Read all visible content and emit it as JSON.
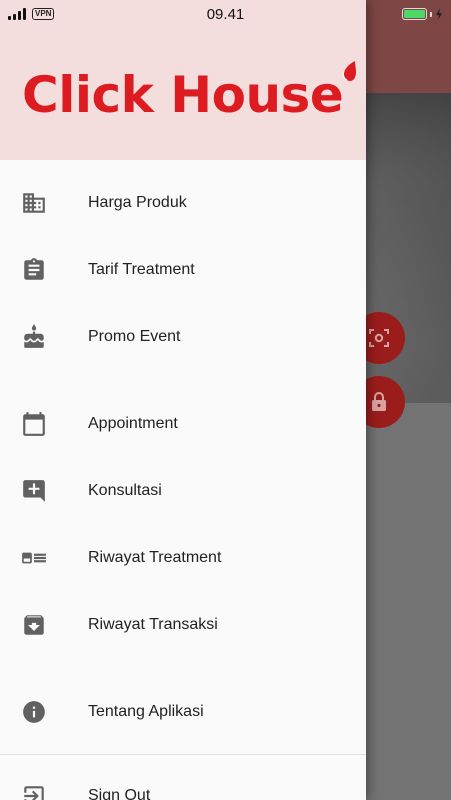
{
  "status_bar": {
    "vpn": "VPN",
    "time": "09.41"
  },
  "app": {
    "logo_text": "Click House",
    "brand_color": "#dd1c22",
    "header_color": "#f4dedd"
  },
  "menu": {
    "items": [
      {
        "label": "Harga Produk",
        "icon": "building-icon"
      },
      {
        "label": "Tarif Treatment",
        "icon": "clipboard-icon"
      },
      {
        "label": "Promo Event",
        "icon": "cake-icon"
      },
      {
        "label": "Appointment",
        "icon": "calendar-icon"
      },
      {
        "label": "Konsultasi",
        "icon": "add-comment-icon"
      },
      {
        "label": "Riwayat Treatment",
        "icon": "id-card-icon"
      },
      {
        "label": "Riwayat Transaksi",
        "icon": "archive-icon"
      },
      {
        "label": "Tentang Aplikasi",
        "icon": "info-icon"
      },
      {
        "label": "Sign Out",
        "icon": "sign-out-icon"
      }
    ]
  },
  "background": {
    "fab_icons": [
      "scan-face-icon",
      "lock-icon"
    ]
  }
}
